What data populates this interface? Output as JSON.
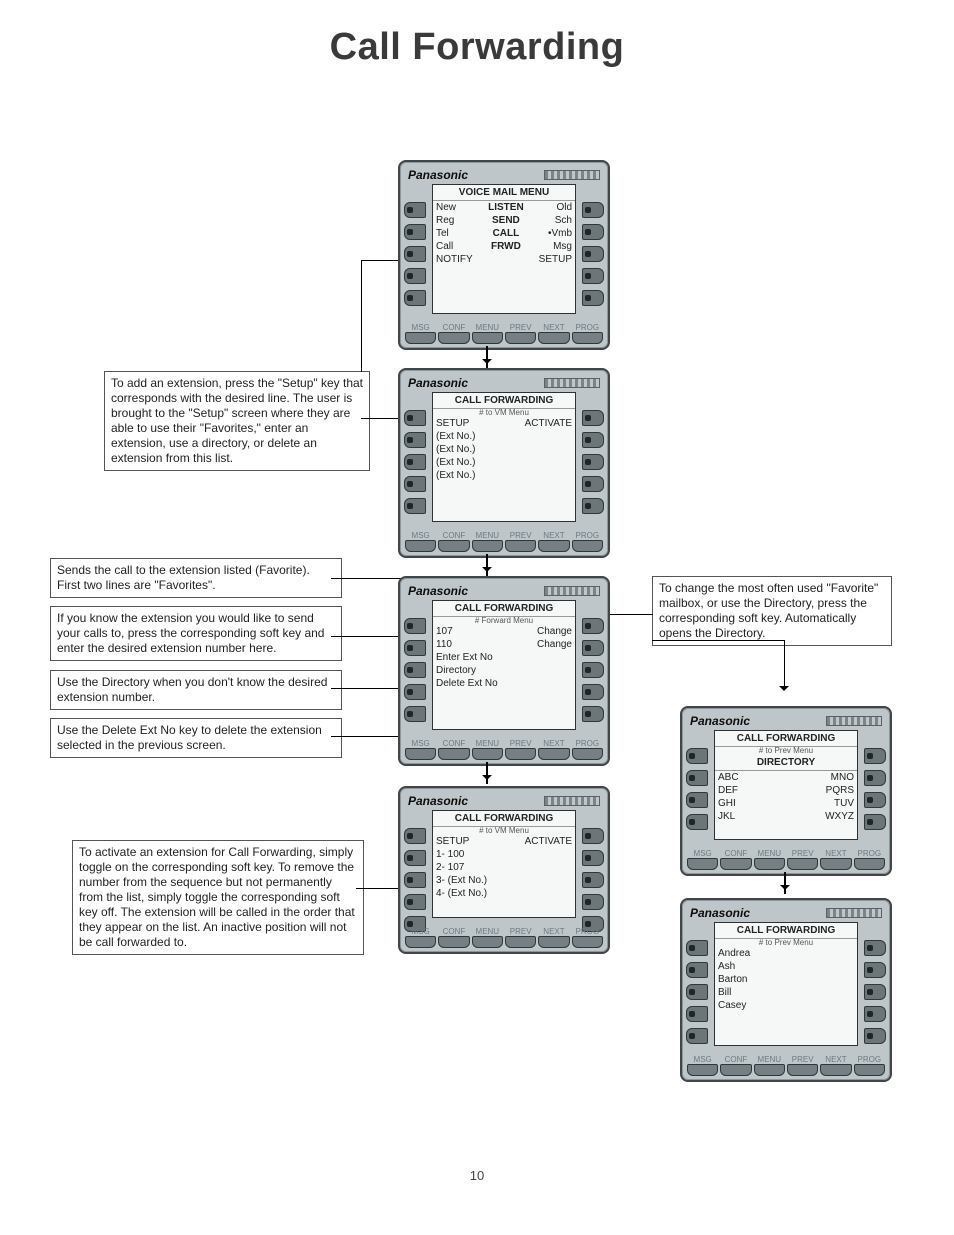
{
  "title": "Call Forwarding",
  "page_number": "10",
  "boxes": {
    "setup": "To add an extension, press the \"Setup\" key that corresponds with the desired line.  The user is brought to the \"Setup\" screen where they are able to use their \"Favorites,\" enter an extension, use a directory, or delete an extension from this list.",
    "favorite": "Sends the call to the extension listed (Favorite).  First two lines are \"Favorites\".",
    "known": "If you know the extension you would like to send your calls to, press the corresponding soft key and enter the desired extension number here.",
    "directory": "Use the Directory when you don't know the desired extension number.",
    "delete": "Use the Delete Ext No key to delete the extension selected in the previous screen.",
    "activate": "To activate an extension for Call Forwarding, simply toggle on the corresponding soft key.  To remove the number from the sequence but not permanently from the list, simply toggle the corresponding soft key off.  The extension will be called in the order that they appear on the list.  An inactive position will not be call forwarded to.",
    "change": "To change the most often used \"Favorite\" mailbox, or use the Directory, press the corresponding soft key.  Automatically opens the Directory."
  },
  "phones": {
    "vm": {
      "brand": "Panasonic",
      "header": "VOICE MAIL MENU",
      "sub": "",
      "rows": [
        [
          "New",
          "LISTEN",
          "Old"
        ],
        [
          "Reg",
          "SEND",
          "Sch"
        ],
        [
          "Tel",
          "CALL",
          "•Vmb"
        ],
        [
          "Call",
          "FRWD",
          "Msg"
        ],
        [
          "NOTIFY",
          "",
          "SETUP"
        ]
      ],
      "bkeys": [
        "MSG",
        "CONF",
        "MENU",
        "PREV",
        "NEXT",
        "PROG"
      ]
    },
    "cf_main": {
      "brand": "Panasonic",
      "header": "CALL FORWARDING",
      "sub": "# to VM Menu",
      "rows": [
        [
          "SETUP",
          "",
          "ACTIVATE"
        ],
        [
          "(Ext No.)",
          "",
          ""
        ],
        [
          "(Ext No.)",
          "",
          ""
        ],
        [
          "(Ext No.)",
          "",
          ""
        ],
        [
          "(Ext No.)",
          "",
          ""
        ]
      ],
      "bkeys": [
        "MSG",
        "CONF",
        "MENU",
        "PREV",
        "NEXT",
        "PROG"
      ]
    },
    "cf_setup": {
      "brand": "Panasonic",
      "header": "CALL FORWARDING",
      "sub": "# Forward Menu",
      "rows": [
        [
          "107",
          "",
          "Change"
        ],
        [
          "110",
          "",
          "Change"
        ],
        [
          "Enter Ext No",
          "",
          ""
        ],
        [
          "Directory",
          "",
          ""
        ],
        [
          "Delete Ext No",
          "",
          ""
        ]
      ],
      "bkeys": [
        "MSG",
        "CONF",
        "MENU",
        "PREV",
        "NEXT",
        "PROG"
      ]
    },
    "cf_activate": {
      "brand": "Panasonic",
      "header": "CALL FORWARDING",
      "sub": "# to VM Menu",
      "rows": [
        [
          "SETUP",
          "",
          "ACTIVATE"
        ],
        [
          "1- 100",
          "",
          ""
        ],
        [
          "2- 107",
          "",
          ""
        ],
        [
          "3- (Ext No.)",
          "",
          ""
        ],
        [
          "4- (Ext No.)",
          "",
          ""
        ]
      ],
      "bkeys": [
        "MSG",
        "CONF",
        "MENU",
        "PREV",
        "NEXT",
        "PROG"
      ]
    },
    "cf_dir_letters": {
      "brand": "Panasonic",
      "header": "CALL FORWARDING",
      "sub": "# to Prev Menu",
      "header2": "DIRECTORY",
      "rows": [
        [
          "ABC",
          "",
          "MNO"
        ],
        [
          "DEF",
          "",
          "PQRS"
        ],
        [
          "GHI",
          "",
          "TUV"
        ],
        [
          "JKL",
          "",
          "WXYZ"
        ]
      ],
      "bkeys": [
        "MSG",
        "CONF",
        "MENU",
        "PREV",
        "NEXT",
        "PROG"
      ]
    },
    "cf_dir_names": {
      "brand": "Panasonic",
      "header": "CALL FORWARDING",
      "sub": "# to Prev Menu",
      "rows": [
        [
          "Andrea",
          "",
          ""
        ],
        [
          "Ash",
          "",
          ""
        ],
        [
          "Barton",
          "",
          ""
        ],
        [
          "Bill",
          "",
          ""
        ],
        [
          "Casey",
          "",
          ""
        ]
      ],
      "bkeys": [
        "MSG",
        "CONF",
        "MENU",
        "PREV",
        "NEXT",
        "PROG"
      ]
    }
  }
}
